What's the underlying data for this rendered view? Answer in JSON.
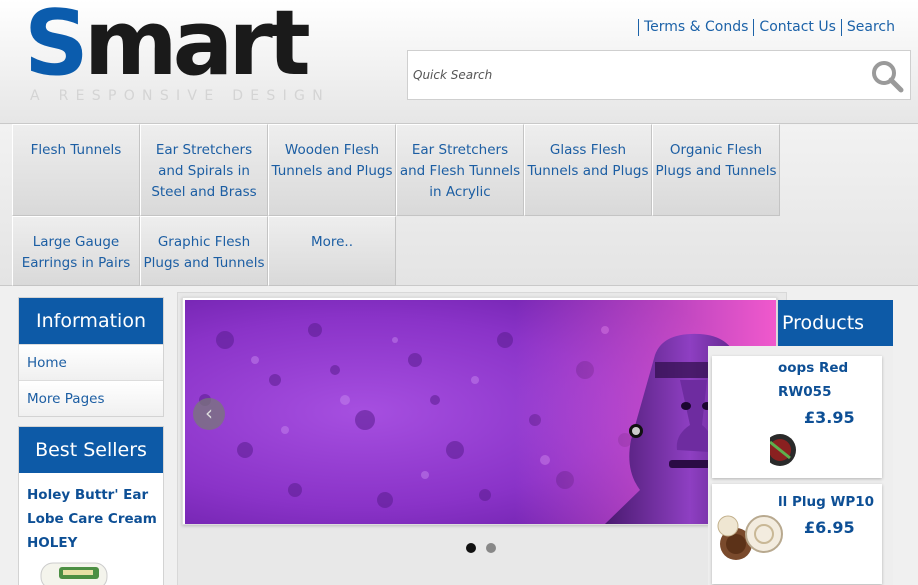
{
  "header": {
    "logo_s": "S",
    "logo_rest": "mart",
    "tagline": "A RESPONSIVE DESIGN",
    "links": [
      "Terms & Conds",
      "Contact Us",
      "Search"
    ],
    "search_placeholder": "Quick Search",
    "search_icon": "magnifier-icon"
  },
  "nav": {
    "items": [
      "Flesh Tunnels",
      "Ear Stretchers and Spirals in Steel and Brass",
      "Wooden Flesh Tunnels and Plugs",
      "Ear Stretchers and Flesh Tunnels in Acrylic",
      "Glass Flesh Tunnels and Plugs",
      "Organic Flesh Plugs and Tunnels",
      "Large Gauge Earrings in Pairs",
      "Graphic Flesh Plugs and Tunnels",
      "More.."
    ]
  },
  "information": {
    "title": "Information",
    "links": [
      "Home",
      "More Pages"
    ]
  },
  "best_sellers": {
    "title": "Best Sellers",
    "product_name": "Holey Buttr' Ear Lobe Care Cream HOLEY"
  },
  "slider": {
    "prev": "‹",
    "next": "›",
    "slide_count": 2,
    "active_slide": 1
  },
  "products": {
    "title": "Products",
    "items": [
      {
        "name_line1": "oops Red",
        "name_line2": "RW055",
        "price": "£3.95"
      },
      {
        "name_line1": "ll Plug WP10",
        "price": "£6.95"
      }
    ]
  },
  "colors": {
    "brand_blue": "#0d5aa7",
    "link_blue": "#1c5ea3",
    "slide_purple": "#9c3fd9"
  }
}
